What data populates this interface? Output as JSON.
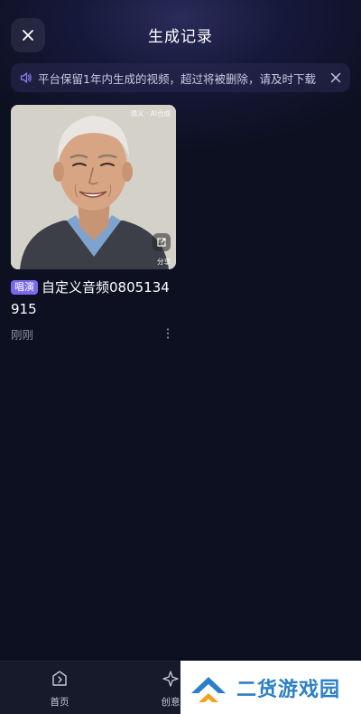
{
  "header": {
    "title": "生成记录"
  },
  "notice": {
    "text": "平台保留1年内生成的视频，超过将被删除，请及时下载"
  },
  "card": {
    "watermark": "通义 · AI合成",
    "share_label": "分享",
    "tag": "唱演",
    "title": "自定义音频0805134915",
    "time": "刚刚"
  },
  "bottom_nav": {
    "items": [
      {
        "label": "首页",
        "icon": "home-icon"
      },
      {
        "label": "创意",
        "icon": "create-icon"
      }
    ]
  },
  "watermark_badge": {
    "text": "二货游戏园"
  },
  "colors": {
    "background": "#0d1020",
    "tag": "#7b68ee",
    "badge_text": "#2b7fc5"
  }
}
